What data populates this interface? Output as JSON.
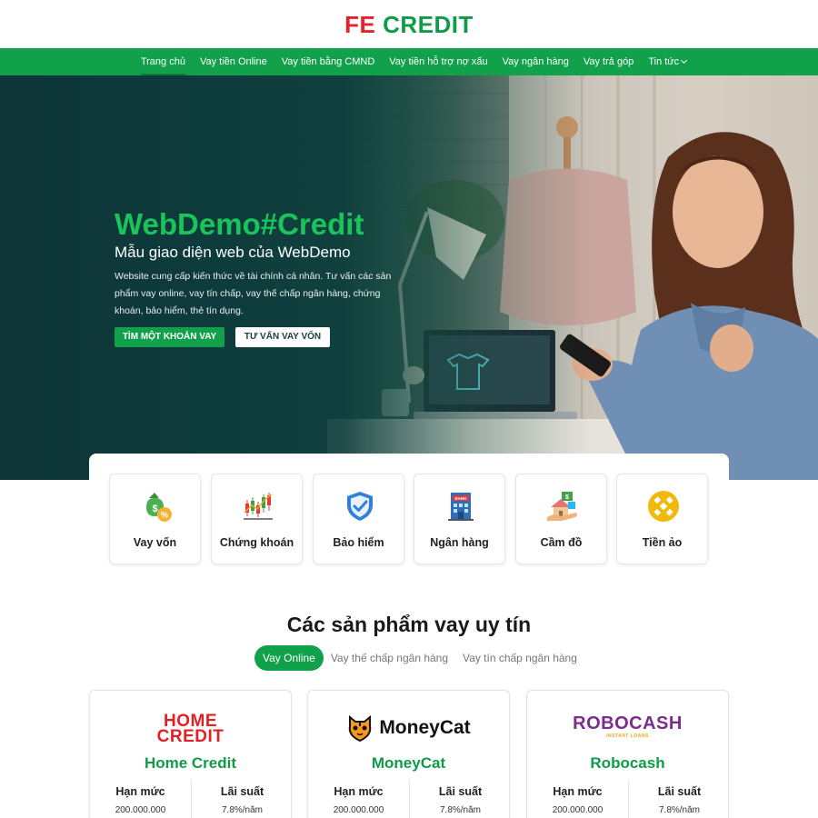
{
  "header": {
    "logo_fe": "FE",
    "logo_credit": "CREDIT"
  },
  "nav": {
    "items": [
      {
        "label": "Trang chủ"
      },
      {
        "label": "Vay tiền Online"
      },
      {
        "label": "Vay tiền bằng CMND"
      },
      {
        "label": "Vay tiền hỗ trợ nợ xấu"
      },
      {
        "label": "Vay ngân hàng"
      },
      {
        "label": "Vay trả góp"
      },
      {
        "label": "Tin tức"
      }
    ]
  },
  "hero": {
    "title": "WebDemo#Credit",
    "subtitle": "Mẫu giao diện web của WebDemo",
    "description": "Website cung cấp kiến thức về tài chính cá nhân. Tư vấn các sản phẩm vay online, vay tín chấp, vay thế chấp ngân hàng, chứng khoán, bảo hiểm, thẻ tín dụng.",
    "primary_button": "TÌM MỘT KHOẢN VAY",
    "secondary_button": "TƯ VẤN VAY VỐN"
  },
  "categories": [
    {
      "label": "Vay vốn",
      "icon": "money-bag-icon"
    },
    {
      "label": "Chứng khoán",
      "icon": "candlestick-chart-icon"
    },
    {
      "label": "Bảo hiểm",
      "icon": "shield-check-icon"
    },
    {
      "label": "Ngân hàng",
      "icon": "bank-building-icon"
    },
    {
      "label": "Cầm đồ",
      "icon": "pawn-house-icon"
    },
    {
      "label": "Tiền ảo",
      "icon": "crypto-coin-icon"
    }
  ],
  "products": {
    "title": "Các sản phẩm vay uy tín",
    "tabs": [
      {
        "label": "Vay Online"
      },
      {
        "label": "Vay thế chấp ngân hàng"
      },
      {
        "label": "Vay tín chấp ngân hàng"
      }
    ],
    "cards": [
      {
        "logo_line1": "HOME",
        "logo_line2": "CREDIT",
        "name": "Home Credit",
        "limit_label": "Hạn mức",
        "limit_value": "200.000.000",
        "rate_label": "Lãi suất",
        "rate_value": "7.8%/năm"
      },
      {
        "logo_text": "MoneyCat",
        "name": "MoneyCat",
        "limit_label": "Hạn mức",
        "limit_value": "200.000.000",
        "rate_label": "Lãi suất",
        "rate_value": "7.8%/năm"
      },
      {
        "logo_text": "ROBOCASH",
        "logo_sub": "INSTANT LOANS",
        "name": "Robocash",
        "limit_label": "Hạn mức",
        "limit_value": "200.000.000",
        "rate_label": "Lãi suất",
        "rate_value": "7.8%/năm"
      }
    ]
  },
  "colors": {
    "brand_green": "#11a14a",
    "brand_red": "#e8202a",
    "hero_title_green": "#19c45a"
  }
}
